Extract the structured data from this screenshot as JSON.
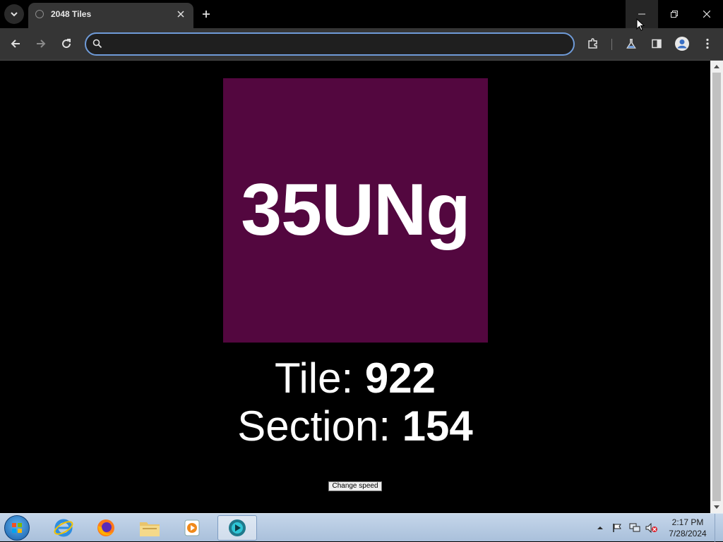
{
  "browser": {
    "tab_title": "2048 Tiles",
    "omnibox_value": "",
    "icons": {
      "tab_search": "chevron-down-icon",
      "favicon": "globe-icon",
      "tab_close": "close-icon",
      "new_tab": "plus-icon",
      "back": "back-arrow-icon",
      "forward": "forward-arrow-icon",
      "reload": "reload-icon",
      "omnibox": "search-icon",
      "extensions": "puzzle-icon",
      "labs": "flask-icon",
      "side_panel": "side-panel-icon",
      "profile": "avatar-icon",
      "menu": "kebab-menu-icon"
    }
  },
  "page": {
    "tile_text": "35UNg",
    "tile_color": "#53073f",
    "tile_label": "Tile: ",
    "tile_number": "922",
    "section_label": "Section: ",
    "section_number": "154",
    "change_speed_label": "Change speed"
  },
  "taskbar": {
    "apps": [
      "internet-explorer",
      "firefox",
      "file-explorer",
      "media-player",
      "active-app"
    ],
    "time": "2:17 PM",
    "date": "7/28/2024",
    "tray_icons": [
      "show-hidden-icons",
      "action-center-flag-icon",
      "network-icon",
      "volume-muted-icon"
    ]
  }
}
